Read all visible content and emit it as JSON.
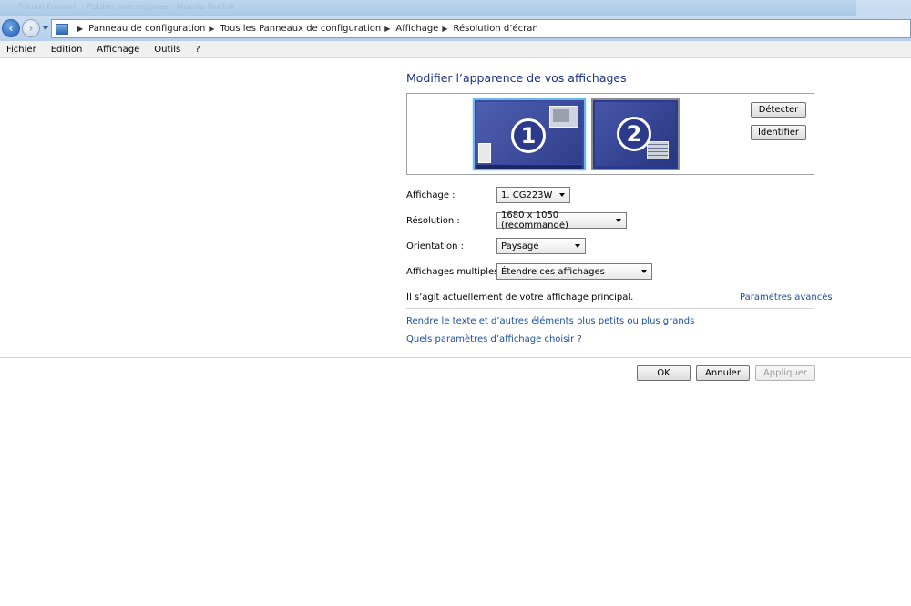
{
  "titlebar": {
    "faded_text": "Forum Forumfr · Publier une réponse · Mozilla Firefox"
  },
  "address": {
    "breadcrumbs": [
      "Panneau de configuration",
      "Tous les Panneaux de configuration",
      "Affichage",
      "Résolution d’écran"
    ]
  },
  "menu": [
    "Fichier",
    "Edition",
    "Affichage",
    "Outils",
    "?"
  ],
  "page": {
    "title": "Modifier l’apparence de vos affichages",
    "monitors": [
      {
        "number": "1",
        "selected": true
      },
      {
        "number": "2",
        "selected": false
      }
    ],
    "buttons": {
      "detect": "Détecter",
      "identify": "Identifier"
    },
    "fields": {
      "display_label": "Affichage :",
      "display_value": "1. CG223W",
      "resolution_label": "Résolution :",
      "resolution_value": "1680 x 1050 (recommandé)",
      "orientation_label": "Orientation :",
      "orientation_value": "Paysage",
      "multiple_label": "Affichages multiples :",
      "multiple_value": "Étendre ces affichages"
    },
    "info_text": "Il s’agit actuellement de votre affichage principal.",
    "advanced_link": "Paramètres avancés",
    "links": [
      "Rendre le texte et d’autres éléments plus petits ou plus grands",
      "Quels paramètres d’affichage choisir ?"
    ],
    "actions": {
      "ok": "OK",
      "cancel": "Annuler",
      "apply": "Appliquer"
    }
  },
  "colors": {
    "title": "#1e3287",
    "link": "#1b4f9c",
    "monitor_selected_border": "#6fb6f0"
  }
}
